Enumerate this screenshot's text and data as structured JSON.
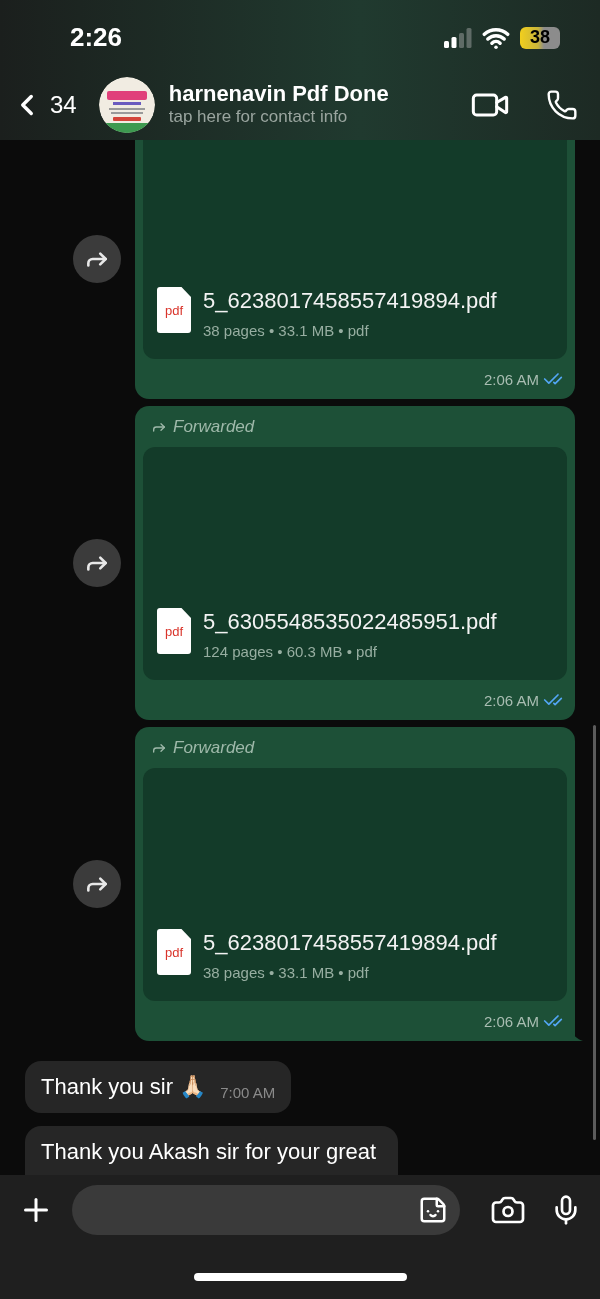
{
  "status_bar": {
    "time": "2:26",
    "battery": "38",
    "low_power": true
  },
  "header": {
    "back_count": "34",
    "title": "harnenavin Pdf Done",
    "subtitle": "tap here for contact info"
  },
  "messages": [
    {
      "kind": "file",
      "file_icon": "pdf",
      "file_name": "5_6238017458557419894.pdf",
      "file_meta": "38 pages • 33.1 MB • pdf",
      "time": "2:06 AM",
      "read": true,
      "tail": false
    },
    {
      "kind": "file",
      "forwarded_label": "Forwarded",
      "file_icon": "pdf",
      "file_name": "5_6305548535022485951.pdf",
      "file_meta": "124 pages • 60.3 MB • pdf",
      "time": "2:06 AM",
      "read": true,
      "tail": false
    },
    {
      "kind": "file",
      "forwarded_label": "Forwarded",
      "file_icon": "pdf",
      "file_name": "5_6238017458557419894.pdf",
      "file_meta": "38 pages • 33.1 MB • pdf",
      "time": "2:06 AM",
      "read": true,
      "tail": true
    },
    {
      "kind": "text",
      "text": "Thank you sir 🙏🏻",
      "time": "7:00 AM"
    },
    {
      "kind": "text",
      "text": "Thank you Akash sir for your great"
    }
  ]
}
